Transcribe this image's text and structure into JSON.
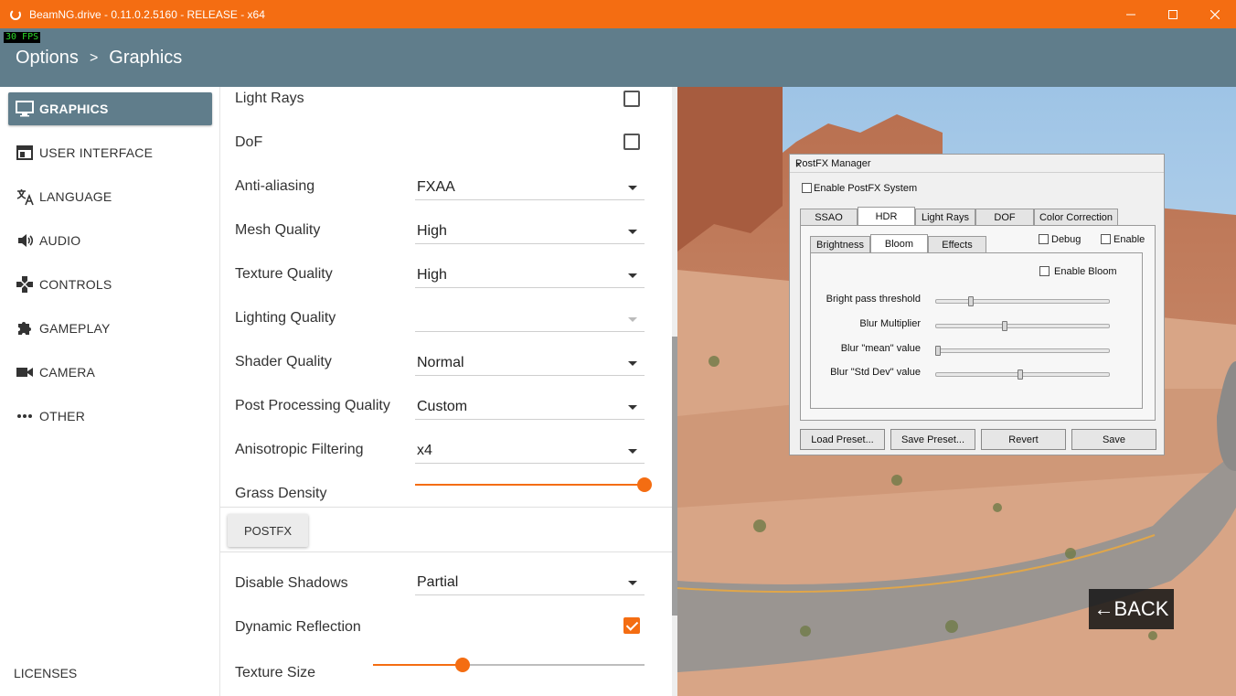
{
  "window": {
    "title": "BeamNG.drive - 0.11.0.2.5160 - RELEASE - x64",
    "accent": "#f46d12",
    "header_color": "#607d8b"
  },
  "header": {
    "fps": "30 FPS",
    "crumb_root": "Options",
    "crumb_sep": ">",
    "crumb_current": "Graphics"
  },
  "sidebar": {
    "items": [
      {
        "label": "GRAPHICS",
        "icon": "monitor-icon",
        "active": true
      },
      {
        "label": "USER INTERFACE",
        "icon": "window-icon"
      },
      {
        "label": "LANGUAGE",
        "icon": "translate-icon"
      },
      {
        "label": "AUDIO",
        "icon": "speaker-icon"
      },
      {
        "label": "CONTROLS",
        "icon": "gamepad-icon"
      },
      {
        "label": "GAMEPLAY",
        "icon": "puzzle-icon"
      },
      {
        "label": "CAMERA",
        "icon": "videocam-icon"
      },
      {
        "label": "OTHER",
        "icon": "more-icon"
      }
    ],
    "licenses": "LICENSES"
  },
  "settings": {
    "light_rays": {
      "label": "Light Rays",
      "checked": false
    },
    "dof": {
      "label": "DoF",
      "checked": false
    },
    "anti_aliasing": {
      "label": "Anti-aliasing",
      "value": "FXAA"
    },
    "mesh_quality": {
      "label": "Mesh Quality",
      "value": "High"
    },
    "texture_quality": {
      "label": "Texture Quality",
      "value": "High"
    },
    "lighting_quality": {
      "label": "Lighting Quality",
      "value": ""
    },
    "shader_quality": {
      "label": "Shader Quality",
      "value": "Normal"
    },
    "post_processing": {
      "label": "Post Processing Quality",
      "value": "Custom"
    },
    "anisotropic": {
      "label": "Anisotropic Filtering",
      "value": "x4"
    },
    "grass_density": {
      "label": "Grass Density",
      "level": 1.0
    },
    "postfx_button": "POSTFX",
    "disable_shadows": {
      "label": "Disable Shadows",
      "value": "Partial"
    },
    "dynamic_reflection": {
      "label": "Dynamic Reflection",
      "checked": true
    },
    "texture_size": {
      "label": "Texture Size",
      "level": 0.33
    }
  },
  "postfx": {
    "title": "PostFX Manager",
    "close": "×",
    "enable_system": "Enable PostFX System",
    "tabs": [
      "SSAO",
      "HDR",
      "Light Rays",
      "DOF",
      "Color Correction"
    ],
    "selected_tab": "HDR",
    "subtabs": [
      "Brightness",
      "Bloom",
      "Effects"
    ],
    "selected_subtab": "Bloom",
    "debug": "Debug",
    "enable": "Enable",
    "enable_bloom": "Enable Bloom",
    "sliders": [
      {
        "label": "Bright pass threshold",
        "level": 0.19
      },
      {
        "label": "Blur Multiplier",
        "level": 0.38
      },
      {
        "label": "Blur \"mean\" value",
        "level": 0.0
      },
      {
        "label": "Blur \"Std Dev\" value",
        "level": 0.47
      }
    ],
    "buttons": [
      "Load Preset...",
      "Save Preset...",
      "Revert",
      "Save"
    ]
  },
  "back": {
    "arrow": "←",
    "label": "BACK"
  }
}
